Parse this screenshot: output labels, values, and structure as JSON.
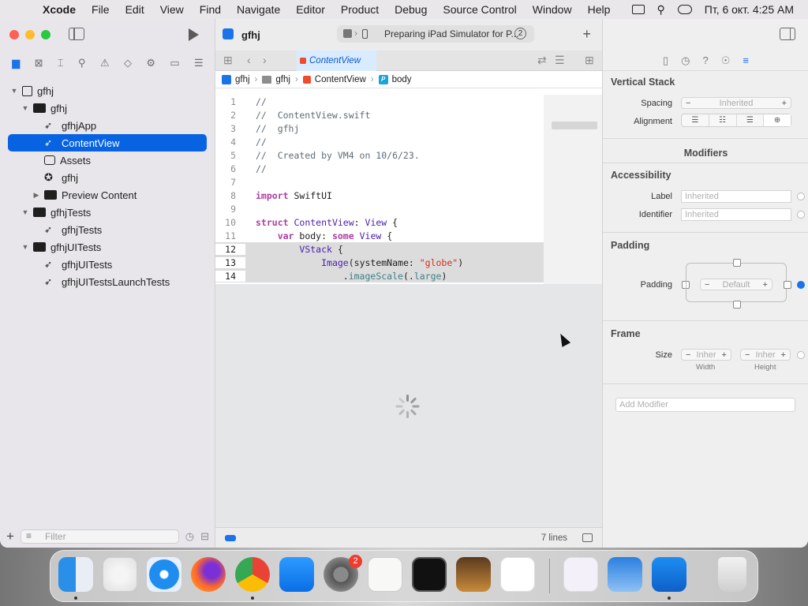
{
  "menubar": {
    "app_name": "Xcode",
    "menus": [
      "File",
      "Edit",
      "View",
      "Find",
      "Navigate",
      "Editor",
      "Product",
      "Debug",
      "Source Control",
      "Window",
      "Help"
    ],
    "clock": "Пт, 6 окт.  4:25 AM"
  },
  "navigator": {
    "tree": [
      {
        "label": "gfhj",
        "level": 0,
        "disclosure": "open",
        "icon": "project-icon"
      },
      {
        "label": "gfhj",
        "level": 1,
        "disclosure": "open",
        "icon": "folder-icon"
      },
      {
        "label": "gfhjApp",
        "level": 2,
        "disclosure": "",
        "icon": "swift-file-icon"
      },
      {
        "label": "ContentView",
        "level": 2,
        "disclosure": "",
        "icon": "swift-file-icon",
        "selected": true
      },
      {
        "label": "Assets",
        "level": 2,
        "disclosure": "",
        "icon": "asset-catalog-icon"
      },
      {
        "label": "gfhj",
        "level": 2,
        "disclosure": "",
        "icon": "entitlements-icon"
      },
      {
        "label": "Preview Content",
        "level": 2,
        "disclosure": "closed",
        "icon": "folder-icon"
      },
      {
        "label": "gfhjTests",
        "level": 1,
        "disclosure": "open",
        "icon": "folder-icon"
      },
      {
        "label": "gfhjTests",
        "level": 2,
        "disclosure": "",
        "icon": "swift-file-icon"
      },
      {
        "label": "gfhjUITests",
        "level": 1,
        "disclosure": "open",
        "icon": "folder-icon"
      },
      {
        "label": "gfhjUITests",
        "level": 2,
        "disclosure": "",
        "icon": "swift-file-icon"
      },
      {
        "label": "gfhjUITestsLaunchTests",
        "level": 2,
        "disclosure": "",
        "icon": "swift-file-icon"
      }
    ],
    "filter_placeholder": "Filter"
  },
  "toolbar": {
    "project": "gfhj",
    "status": "Preparing iPad Simulator for P...",
    "issue_count": "2"
  },
  "editor": {
    "tab": "ContentView",
    "breadcrumb": [
      "gfhj",
      "gfhj",
      "ContentView",
      "body"
    ],
    "footer_lines": "7 lines"
  },
  "inspector": {
    "vertical_stack": "Vertical Stack",
    "spacing_label": "Spacing",
    "spacing_value": "Inherited",
    "alignment_label": "Alignment",
    "modifiers": "Modifiers",
    "accessibility": "Accessibility",
    "label_label": "Label",
    "label_placeholder": "Inherited",
    "identifier_label": "Identifier",
    "identifier_placeholder": "Inherited",
    "padding_section": "Padding",
    "padding_label": "Padding",
    "padding_value": "Default",
    "frame_section": "Frame",
    "size_label": "Size",
    "width_value": "Inher",
    "height_value": "Inher",
    "width_label": "Width",
    "height_label": "Height",
    "add_modifier": "Add Modifier"
  },
  "dock": {
    "settings_badge": "2"
  }
}
